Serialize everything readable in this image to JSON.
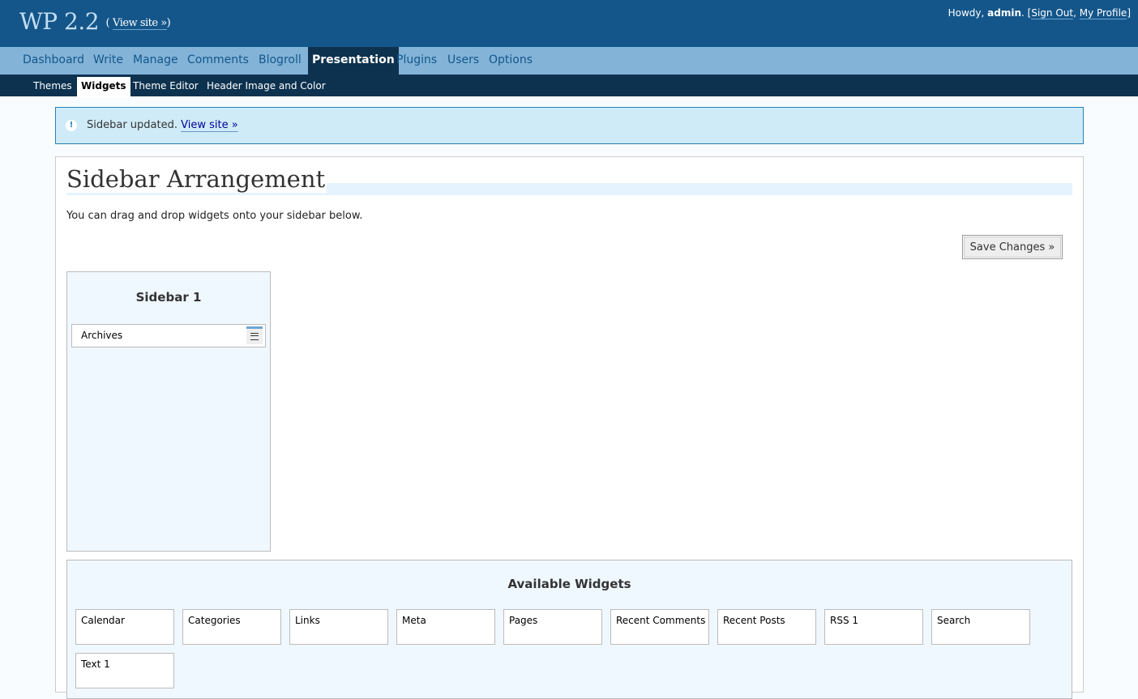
{
  "header": {
    "site_title": "WP 2.2",
    "view_site": "View site »",
    "howdy": "Howdy,",
    "username": "admin",
    "sign_out": "Sign Out",
    "my_profile": "My Profile"
  },
  "menu": {
    "items": [
      "Dashboard",
      "Write",
      "Manage",
      "Comments",
      "Blogroll",
      "Presentation",
      "Plugins",
      "Users",
      "Options"
    ],
    "current": "Presentation"
  },
  "submenu": {
    "items": [
      "Themes",
      "Widgets",
      "Theme Editor",
      "Header Image and Color"
    ],
    "current": "Widgets"
  },
  "notice": {
    "icon": "!",
    "text": "Sidebar updated.",
    "link": "View site »"
  },
  "page": {
    "title": "Sidebar Arrangement",
    "intro": "You can drag and drop widgets onto your sidebar below.",
    "save_label": "Save Changes »"
  },
  "sidebar": {
    "title": "Sidebar 1",
    "widgets": [
      "Archives"
    ]
  },
  "available": {
    "title": "Available Widgets",
    "widgets": [
      "Calendar",
      "Categories",
      "Links",
      "Meta",
      "Pages",
      "Recent Comments",
      "Recent Posts",
      "RSS 1",
      "Search",
      "Text 1"
    ]
  },
  "colors": {
    "header_bg": "#14568a",
    "menu_bg": "#83b4d8",
    "submenu_bg": "#0d324f",
    "notice_bg": "#cfebf7",
    "panel_bg": "#f0f8ff"
  }
}
